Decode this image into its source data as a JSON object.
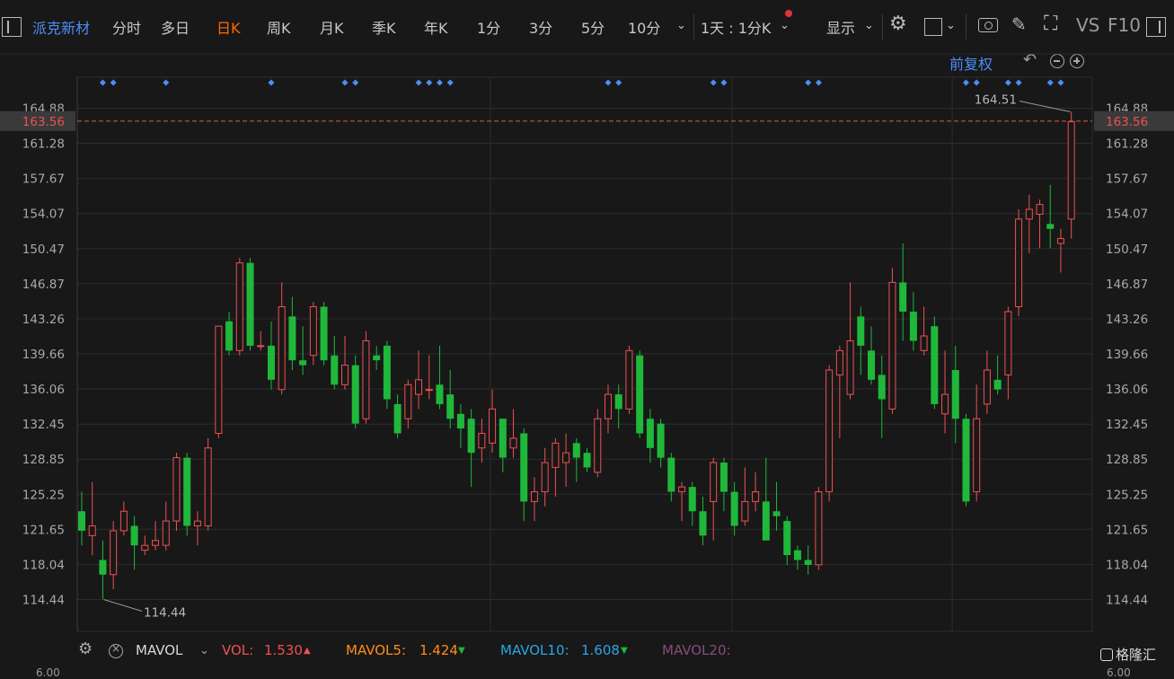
{
  "toolbar": {
    "stock_name": "派克新材",
    "tabs": [
      "分时",
      "多日",
      "日K",
      "周K",
      "月K",
      "季K",
      "年K",
      "1分",
      "3分",
      "5分",
      "10分"
    ],
    "selected_tab": "日K",
    "period_selector": "1天 : 1分K",
    "display_label": "显示",
    "vs_label": "VS",
    "f10_label": "F10"
  },
  "sub_toolbar": {
    "adjust_label": "前复权"
  },
  "colors": {
    "up": "#f05050",
    "down": "#1fb83a",
    "grid": "#2c2c2c",
    "background": "#181818",
    "price_line": "#e05a3a",
    "marker": "#4d8df6",
    "accent": "#ff6a00"
  },
  "chart_data": {
    "type": "candlestick",
    "ylim": [
      112.5,
      166.5
    ],
    "y_ticks": [
      "164.88",
      "161.28",
      "157.67",
      "154.07",
      "150.47",
      "146.87",
      "143.26",
      "139.66",
      "136.06",
      "132.45",
      "128.85",
      "125.25",
      "121.65",
      "118.04",
      "114.44"
    ],
    "current_price": "163.56",
    "max_label": "164.51",
    "min_label": "114.44",
    "marker_bar_indices": [
      2,
      3,
      8,
      18,
      25,
      26,
      32,
      33,
      34,
      35,
      50,
      51,
      60,
      61,
      69,
      70,
      84,
      85,
      88,
      89,
      92,
      93
    ],
    "candles": [
      [
        123.5,
        121.5,
        125.5,
        120.0
      ],
      [
        121.0,
        122.0,
        126.5,
        119.0
      ],
      [
        118.5,
        117.0,
        120.5,
        114.5
      ],
      [
        117.0,
        121.5,
        122.5,
        115.5
      ],
      [
        121.5,
        123.5,
        124.5,
        121.0
      ],
      [
        122.0,
        120.0,
        123.0,
        117.5
      ],
      [
        119.5,
        120.0,
        121.0,
        119.0
      ],
      [
        120.0,
        120.5,
        122.5,
        119.5
      ],
      [
        120.0,
        122.5,
        124.5,
        119.5
      ],
      [
        122.5,
        129.0,
        129.5,
        121.5
      ],
      [
        129.0,
        122.0,
        129.5,
        121.0
      ],
      [
        122.0,
        122.5,
        123.5,
        120.0
      ],
      [
        122.0,
        130.0,
        131.0,
        121.5
      ],
      [
        131.5,
        142.5,
        142.5,
        131.0
      ],
      [
        143.0,
        140.0,
        144.0,
        139.5
      ],
      [
        140.0,
        149.0,
        149.5,
        139.5
      ],
      [
        149.0,
        140.5,
        149.5,
        140.0
      ],
      [
        140.5,
        140.5,
        142.0,
        140.0
      ],
      [
        140.5,
        137.0,
        143.0,
        136.0
      ],
      [
        136.0,
        144.5,
        147.0,
        135.5
      ],
      [
        143.5,
        139.0,
        145.5,
        138.0
      ],
      [
        139.0,
        138.5,
        142.5,
        137.5
      ],
      [
        139.5,
        144.5,
        145.0,
        138.5
      ],
      [
        144.5,
        139.0,
        145.0,
        138.5
      ],
      [
        139.5,
        136.5,
        141.5,
        136.0
      ],
      [
        136.5,
        138.5,
        141.5,
        136.0
      ],
      [
        138.5,
        132.5,
        139.5,
        132.0
      ],
      [
        133.0,
        141.0,
        142.0,
        132.5
      ],
      [
        139.5,
        139.0,
        140.5,
        138.0
      ],
      [
        140.5,
        135.0,
        141.0,
        134.0
      ],
      [
        134.5,
        131.5,
        135.5,
        131.0
      ],
      [
        133.0,
        136.5,
        137.0,
        132.0
      ],
      [
        135.5,
        137.0,
        140.0,
        134.0
      ],
      [
        136.0,
        136.0,
        139.5,
        135.0
      ],
      [
        136.5,
        134.5,
        140.5,
        134.0
      ],
      [
        135.5,
        133.0,
        138.0,
        132.0
      ],
      [
        133.5,
        132.0,
        134.5,
        130.0
      ],
      [
        133.0,
        129.5,
        134.0,
        126.0
      ],
      [
        130.0,
        131.5,
        133.0,
        128.5
      ],
      [
        130.5,
        134.0,
        136.0,
        129.5
      ],
      [
        133.0,
        129.0,
        133.0,
        127.5
      ],
      [
        130.0,
        131.0,
        134.0,
        129.0
      ],
      [
        131.5,
        124.5,
        132.0,
        122.5
      ],
      [
        124.5,
        125.5,
        127.0,
        122.5
      ],
      [
        125.5,
        128.5,
        130.0,
        124.0
      ],
      [
        128.0,
        130.5,
        131.0,
        125.0
      ],
      [
        128.5,
        129.5,
        131.5,
        126.0
      ],
      [
        130.5,
        129.0,
        131.0,
        126.5
      ],
      [
        129.5,
        128.0,
        130.0,
        127.5
      ],
      [
        127.5,
        133.0,
        134.0,
        127.0
      ],
      [
        133.0,
        135.5,
        136.5,
        131.5
      ],
      [
        135.5,
        134.0,
        136.5,
        132.0
      ],
      [
        134.0,
        140.0,
        140.5,
        133.5
      ],
      [
        139.5,
        131.5,
        140.0,
        131.0
      ],
      [
        133.0,
        130.0,
        134.0,
        128.5
      ],
      [
        132.5,
        129.0,
        133.0,
        128.0
      ],
      [
        129.0,
        125.5,
        129.5,
        124.5
      ],
      [
        125.5,
        126.0,
        126.5,
        122.5
      ],
      [
        126.0,
        123.5,
        126.5,
        122.0
      ],
      [
        123.5,
        121.0,
        125.0,
        120.0
      ],
      [
        124.5,
        128.5,
        129.0,
        120.5
      ],
      [
        128.5,
        125.5,
        129.0,
        123.5
      ],
      [
        125.5,
        122.0,
        126.5,
        121.0
      ],
      [
        122.5,
        124.5,
        128.0,
        122.0
      ],
      [
        124.5,
        125.5,
        127.5,
        123.5
      ],
      [
        124.5,
        120.5,
        129.0,
        121.0
      ],
      [
        123.5,
        123.0,
        126.5,
        121.5
      ],
      [
        122.5,
        119.0,
        123.0,
        118.0
      ],
      [
        119.5,
        118.5,
        120.0,
        117.5
      ],
      [
        118.5,
        118.0,
        120.0,
        117.0
      ],
      [
        118.0,
        125.5,
        126.0,
        117.5
      ],
      [
        125.5,
        138.0,
        138.5,
        124.5
      ],
      [
        137.5,
        140.0,
        140.5,
        131.0
      ],
      [
        135.5,
        141.0,
        147.0,
        135.0
      ],
      [
        143.5,
        140.5,
        144.5,
        137.5
      ],
      [
        140.0,
        137.0,
        142.5,
        136.5
      ],
      [
        137.5,
        135.0,
        139.5,
        131.0
      ],
      [
        134.0,
        147.0,
        148.5,
        133.5
      ],
      [
        147.0,
        144.0,
        151.0,
        141.0
      ],
      [
        144.0,
        141.0,
        146.0,
        140.0
      ],
      [
        140.0,
        141.5,
        144.5,
        139.5
      ],
      [
        142.5,
        134.5,
        143.5,
        134.0
      ],
      [
        133.5,
        135.5,
        140.0,
        131.5
      ],
      [
        138.0,
        133.0,
        140.5,
        130.5
      ],
      [
        133.0,
        124.5,
        133.5,
        124.0
      ],
      [
        125.5,
        133.0,
        136.5,
        124.5
      ],
      [
        134.5,
        138.0,
        140.0,
        133.5
      ],
      [
        137.0,
        136.0,
        139.5,
        135.5
      ],
      [
        137.5,
        144.0,
        144.5,
        135.0
      ],
      [
        144.5,
        153.5,
        154.5,
        143.5
      ],
      [
        153.5,
        154.5,
        156.0,
        150.0
      ],
      [
        154.0,
        155.0,
        155.5,
        150.5
      ],
      [
        153.0,
        152.5,
        157.0,
        150.5
      ],
      [
        151.0,
        151.5,
        152.5,
        148.0
      ],
      [
        153.5,
        163.5,
        164.5,
        151.5
      ]
    ]
  },
  "bottom_bar": {
    "indicator": "MAVOL",
    "vol_label": "VOL:",
    "vol_value": "1.530",
    "mavol5_label": "MAVOL5:",
    "mavol5_value": "1.424",
    "mavol10_label": "MAVOL10:",
    "mavol10_value": "1.608",
    "mavol20_label": "MAVOL20:",
    "lower_tick_left": "6.00",
    "lower_tick_right": "6.00",
    "watermark": "格隆汇"
  }
}
